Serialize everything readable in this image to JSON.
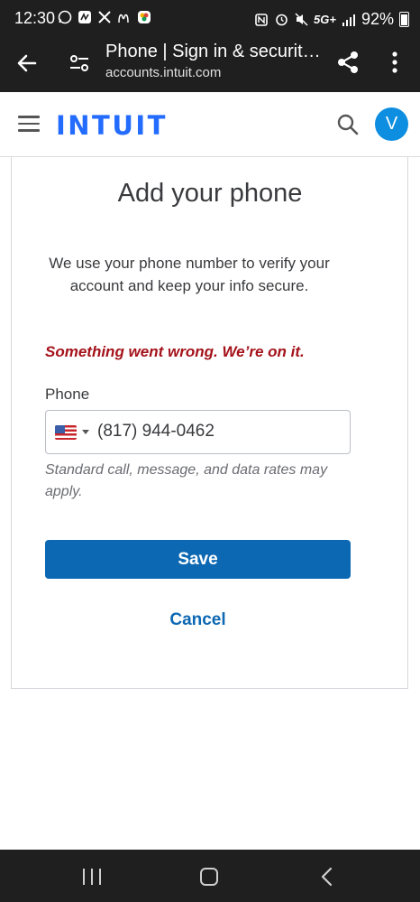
{
  "status_bar": {
    "time": "12:30",
    "left_icons": [
      "whatsapp-icon",
      "app-icon",
      "x-icon",
      "mcdonalds-icon",
      "photos-icon"
    ],
    "right_icons": [
      "nfc-icon",
      "alarm-icon",
      "mute-icon",
      "5g-icon",
      "signal-icon"
    ],
    "network": "5G+",
    "battery": "92%"
  },
  "browser": {
    "title": "Phone | Sign in & security | Intuit",
    "url": "accounts.intuit.com"
  },
  "header": {
    "logo": "INTUIT",
    "avatar_initial": "V"
  },
  "form": {
    "title": "Add your phone",
    "description": "We use your phone number to verify your account and keep your info secure.",
    "error": "Something went wrong. We’re on it.",
    "phone_label": "Phone",
    "phone_value": "(817) 944-0462",
    "country_flag": "us-flag",
    "hint": "Standard call, message, and data rates may apply.",
    "save_label": "Save",
    "cancel_label": "Cancel"
  },
  "colors": {
    "brand_blue": "#236cff",
    "button_blue": "#0d68b3",
    "error_red": "#a4121a",
    "avatar_blue": "#0d8ee0"
  }
}
